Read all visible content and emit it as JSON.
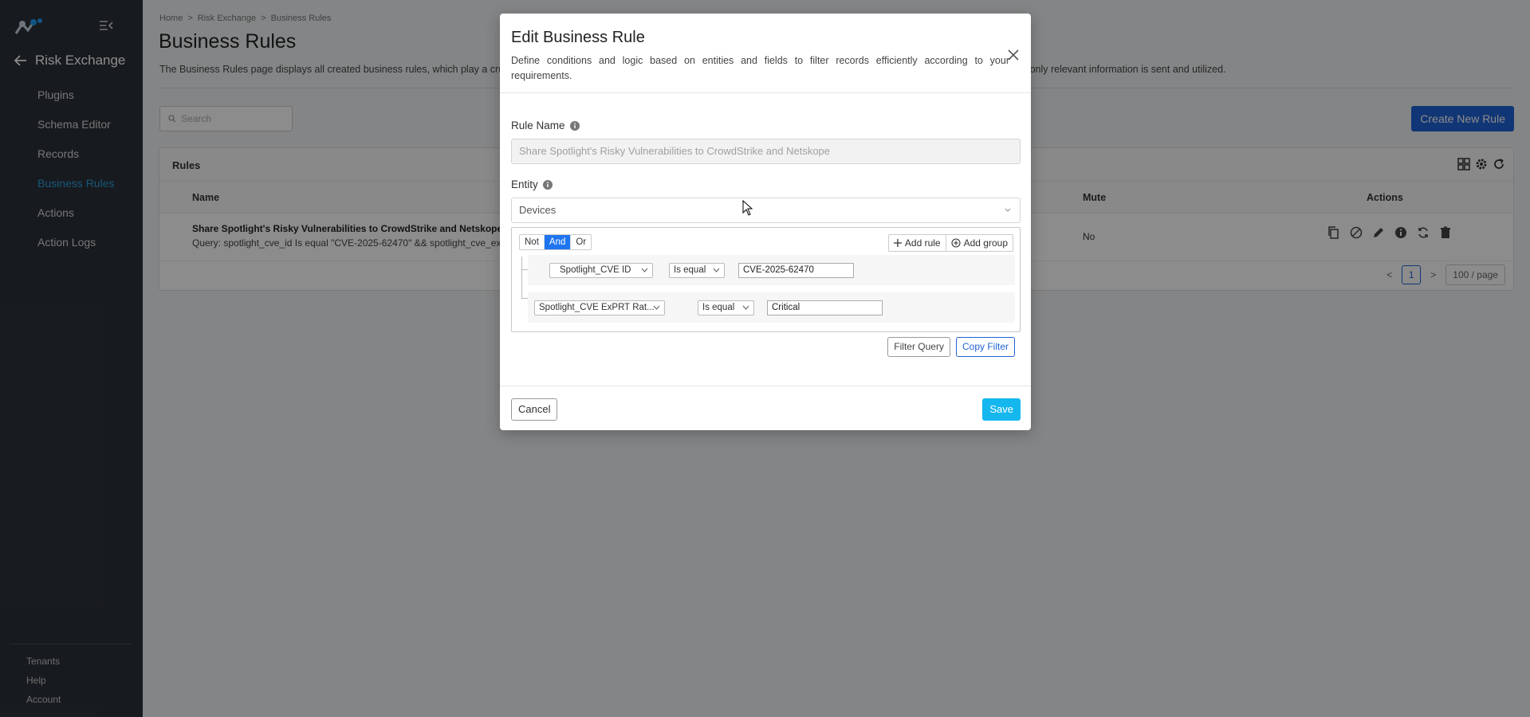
{
  "sidebar": {
    "title": "Risk Exchange",
    "items": [
      {
        "label": "Plugins"
      },
      {
        "label": "Schema Editor"
      },
      {
        "label": "Records"
      },
      {
        "label": "Business Rules",
        "active": true
      },
      {
        "label": "Actions"
      },
      {
        "label": "Action Logs"
      }
    ],
    "bottom": [
      {
        "label": "Tenants"
      },
      {
        "label": "Help"
      },
      {
        "label": "Account"
      }
    ],
    "active_color": "#2f9fe0",
    "background": "#2b3138"
  },
  "page": {
    "breadcrumb": [
      "Home",
      ">",
      "Risk Exchange",
      ">",
      "Business Rules"
    ],
    "title": "Business Rules",
    "description": "The Business Rules page displays all created business rules, which play a crucial role in defining how data is filtered and shared across plugins. Rules that streamline data processing, ensuring that only relevant information is sent and utilized.",
    "search_placeholder": "Search",
    "create_button": "Create New Rule",
    "card_title": "Rules",
    "columns": {
      "name": "Name",
      "mute": "Mute",
      "actions": "Actions"
    },
    "row": {
      "name": "Share Spotlight's Risky Vulnerabilities to CrowdStrike and Netskope",
      "query": "Query: spotlight_cve_id Is equal \"CVE-2025-62470\" && spotlight_cve_exprt_",
      "mute": "No"
    },
    "pagination": {
      "prev": "<",
      "page": "1",
      "next": ">",
      "per_page": "100 / page"
    }
  },
  "modal": {
    "title": "Edit Business Rule",
    "description": "Define conditions and logic based on entities and fields to filter records efficiently according to your requirements.",
    "rule_name_label": "Rule Name",
    "rule_name_value": "Share Spotlight's Risky Vulnerabilities to CrowdStrike and Netskope",
    "entity_label": "Entity",
    "entity_value": "Devices",
    "combinators": [
      "Not",
      "And",
      "Or"
    ],
    "active_combinator": "And",
    "add_rule": "Add rule",
    "add_group": "Add group",
    "rules": [
      {
        "field": "Spotlight_CVE ID",
        "operator": "Is equal",
        "value": "CVE-2025-62470"
      },
      {
        "field": "Spotlight_CVE ExPRT Rat...",
        "operator": "Is equal",
        "value": "Critical"
      }
    ],
    "filter_query": "Filter Query",
    "copy_filter": "Copy Filter",
    "cancel": "Cancel",
    "save": "Save",
    "save_color": "#14b7ee"
  }
}
